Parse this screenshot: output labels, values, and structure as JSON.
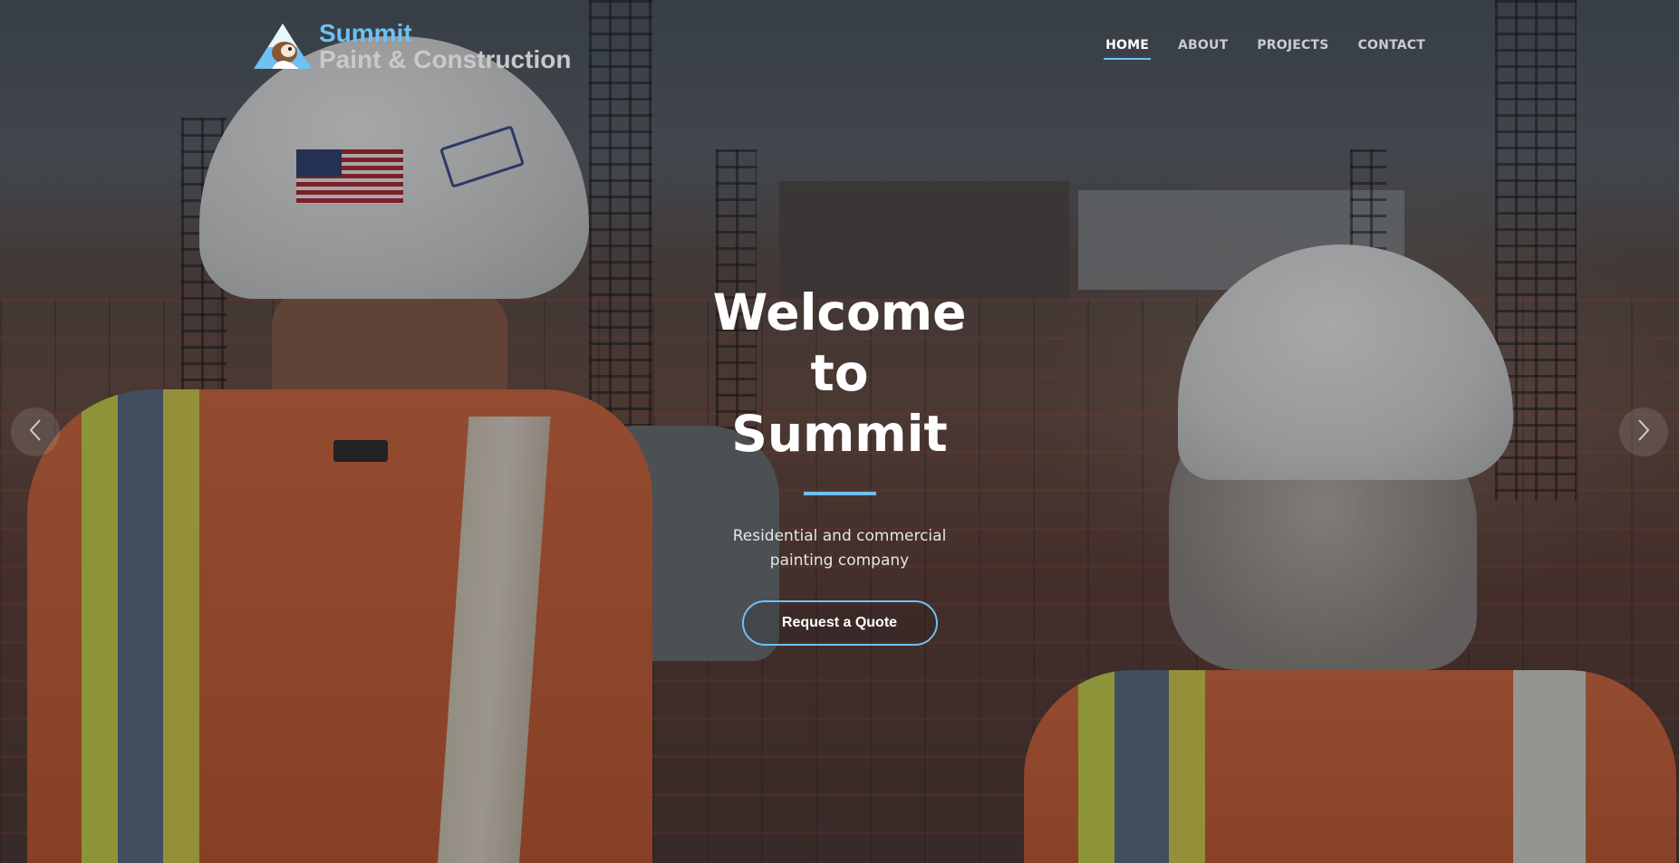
{
  "brand": {
    "name": "Summit",
    "tagline": "Paint & Construction",
    "logo_icon": "mountain-logo-icon",
    "accent_color": "#6ec1f2"
  },
  "nav": {
    "items": [
      {
        "label": "HOME",
        "active": true
      },
      {
        "label": "ABOUT",
        "active": false
      },
      {
        "label": "PROJECTS",
        "active": false
      },
      {
        "label": "CONTACT",
        "active": false
      }
    ]
  },
  "hero": {
    "title": "Welcome to Summit",
    "subtitle": "Residential and commercial painting company",
    "cta_label": "Request a Quote"
  },
  "carousel": {
    "prev_icon": "chevron-left-icon",
    "next_icon": "chevron-right-icon"
  }
}
